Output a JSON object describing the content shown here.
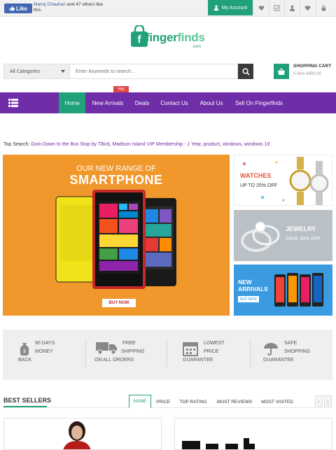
{
  "topbar": {
    "like_label": "Like",
    "social_name": "Manoj Chauhan",
    "social_text": "and 47 others like this.",
    "account_label": "My Account",
    "icons": [
      "heart-icon",
      "compare-icon",
      "user-icon",
      "heart-icon",
      "lock-icon"
    ]
  },
  "logo": {
    "main": "finger",
    "accent": "finds",
    "suffix": ".com"
  },
  "search": {
    "category": "All Categories",
    "placeholder": "Enter keywords to search..."
  },
  "cart": {
    "title": "SHOPPING CART",
    "summary": "0 item  INR0.00"
  },
  "nav": {
    "badge": "Hot",
    "items": [
      "Home",
      "New Arrivals",
      "Deals",
      "Contact Us",
      "About Us",
      "Sell On Fingerfinds"
    ]
  },
  "top_search": {
    "label": "Top Search:",
    "links": [
      "Goin Down to the Bus Stop by TBird",
      "Madison Island VIP Membership - 1 Year",
      "product",
      "windows",
      "windows 10"
    ]
  },
  "banner": {
    "subtitle": "OUR NEW RANGE OF",
    "title": "SMARTPHONE",
    "button": "BUY NOW"
  },
  "promos": {
    "watches": {
      "title": "WATCHES",
      "sub": "UP TO 25% OFF"
    },
    "jewelry": {
      "title": "JEWELRY",
      "sub": "SAVE 40% OFF"
    },
    "arrivals": {
      "line1": "NEW",
      "line2": "ARRIVALS",
      "button": "BUY NOW"
    }
  },
  "features": [
    {
      "icon": "money-bag-icon",
      "lines": [
        "90 DAYS",
        "MONEY",
        "BACK"
      ]
    },
    {
      "icon": "truck-icon",
      "lines": [
        "FREE",
        "SHIPPING",
        "ON ALL ORDERS"
      ]
    },
    {
      "icon": "calendar-icon",
      "lines": [
        "LOWEST",
        "PRICE",
        "GUARANTEE"
      ]
    },
    {
      "icon": "umbrella-icon",
      "lines": [
        "SAFE",
        "SHOPPING",
        "GUARANTEE"
      ]
    }
  ],
  "best_sellers": {
    "title": "BEST SELLERS",
    "tabs": [
      "NAME",
      "PRICE",
      "TOP RATING",
      "MOST REVIEWS",
      "MOST VISITED"
    ],
    "active_tab": "NAME"
  },
  "colors": {
    "brand_green": "#21a179",
    "nav_purple": "#6f2da8",
    "banner_orange": "#f0982c"
  }
}
